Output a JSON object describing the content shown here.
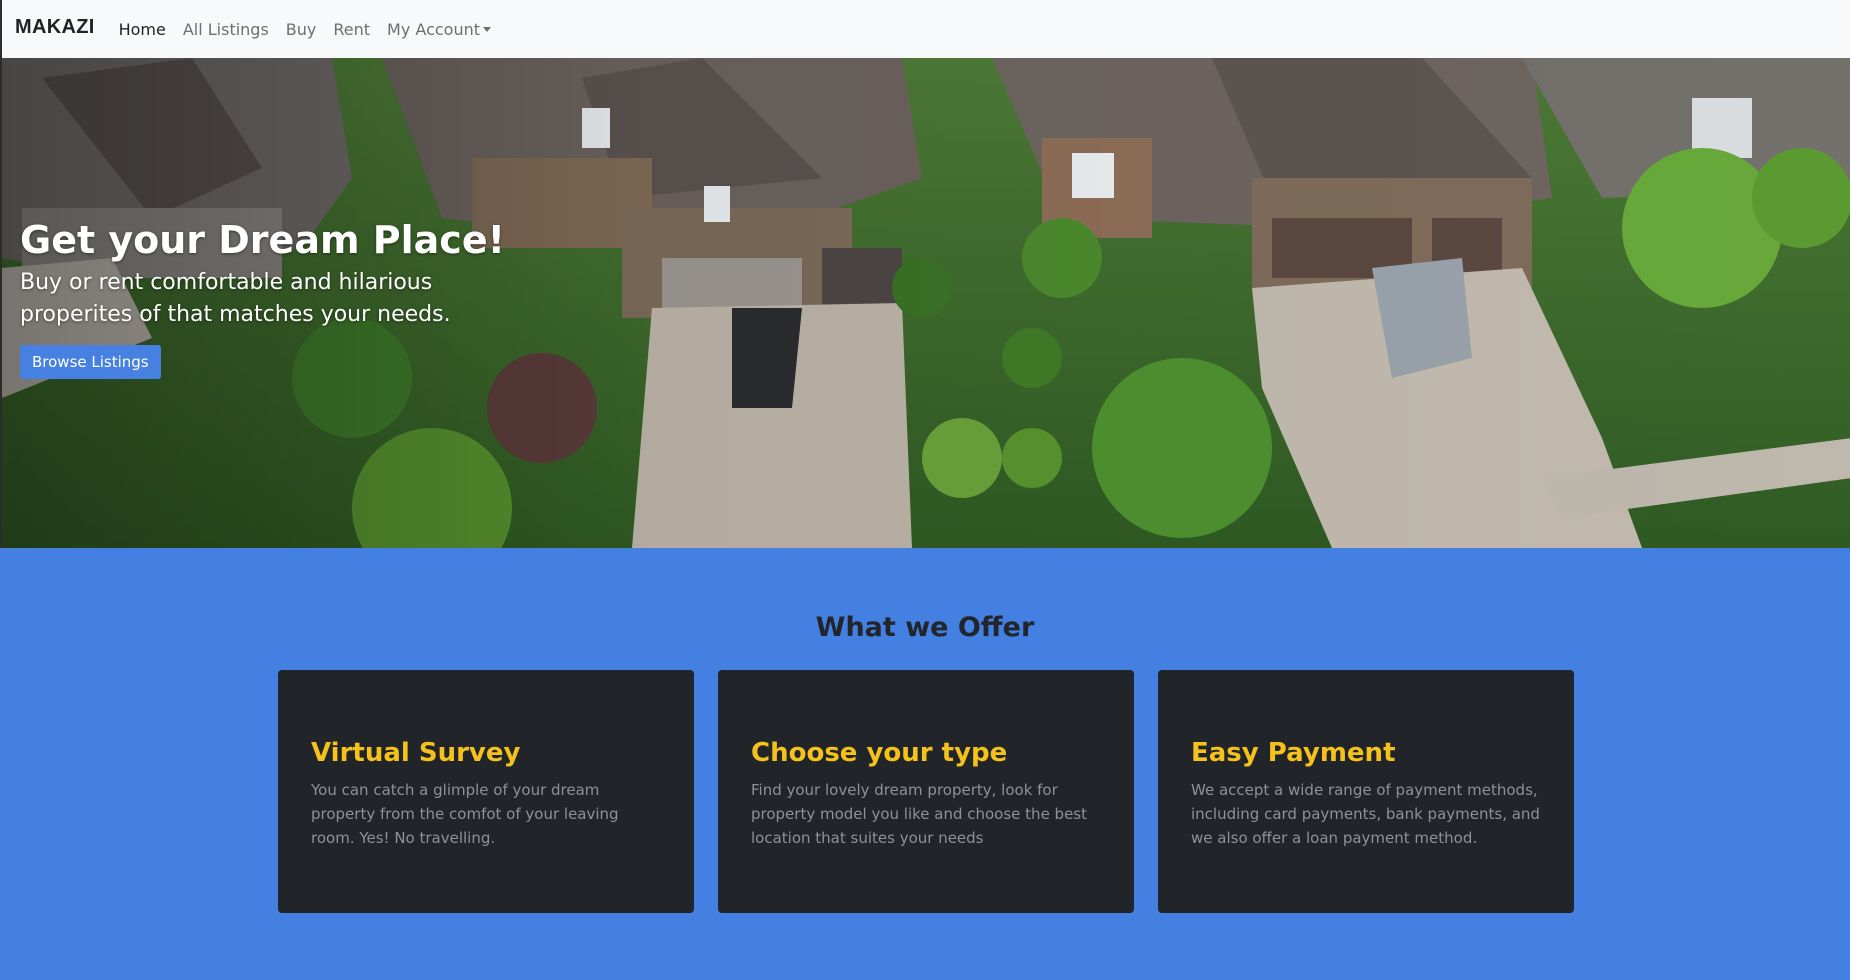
{
  "navbar": {
    "brand": "MAKAZI",
    "links": [
      {
        "label": "Home",
        "active": true
      },
      {
        "label": "All Listings",
        "active": false
      },
      {
        "label": "Buy",
        "active": false
      },
      {
        "label": "Rent",
        "active": false
      },
      {
        "label": "My Account",
        "active": false,
        "dropdown": true
      }
    ]
  },
  "hero": {
    "title": "Get your Dream Place!",
    "subtitle": "Buy or rent comfortable and hilarious properites of that matches your needs.",
    "button_label": "Browse Listings"
  },
  "offer": {
    "title": "What we Offer",
    "cards": [
      {
        "title": "Virtual Survey",
        "text": "You can catch a glimple of your dream property from the comfot of your leaving room. Yes! No travelling."
      },
      {
        "title": "Choose your type",
        "text": "Find your lovely dream property, look for property model you like and choose the best location that suites your needs"
      },
      {
        "title": "Easy Payment",
        "text": "We accept a wide range of payment methods, including card payments, bank payments, and we also offer a loan payment method."
      }
    ]
  },
  "colors": {
    "accent_blue": "#447fe2",
    "card_bg": "#212529",
    "card_title": "#f4c21a",
    "navbar_bg": "#f8f9fa"
  }
}
